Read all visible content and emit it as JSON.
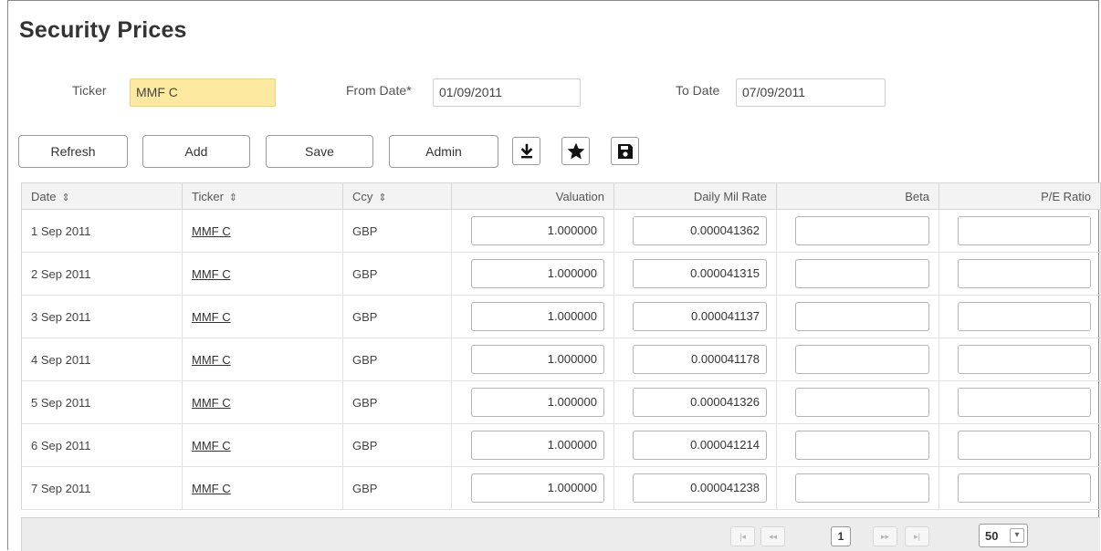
{
  "page": {
    "title": "Security Prices"
  },
  "filters": {
    "ticker_label": "Ticker",
    "ticker_value": "MMF C",
    "from_label": "From Date*",
    "from_value": "01/09/2011",
    "to_label": "To Date",
    "to_value": "07/09/2011"
  },
  "toolbar": {
    "refresh": "Refresh",
    "add": "Add",
    "save": "Save",
    "admin": "Admin",
    "icons": [
      "download-icon",
      "star-icon",
      "floppy-disk-icon"
    ]
  },
  "table": {
    "sort_glyph": "⇕",
    "columns": [
      "Date",
      "Ticker",
      "Ccy",
      "Valuation",
      "Daily Mil Rate",
      "Beta",
      "P/E Ratio"
    ],
    "rows": [
      {
        "date": "1 Sep 2011",
        "ticker": "MMF C",
        "ccy": "GBP",
        "valuation": "1.000000",
        "rate": "0.000041362",
        "beta": "",
        "pe": ""
      },
      {
        "date": "2 Sep 2011",
        "ticker": "MMF C",
        "ccy": "GBP",
        "valuation": "1.000000",
        "rate": "0.000041315",
        "beta": "",
        "pe": ""
      },
      {
        "date": "3 Sep 2011",
        "ticker": "MMF C",
        "ccy": "GBP",
        "valuation": "1.000000",
        "rate": "0.000041137",
        "beta": "",
        "pe": ""
      },
      {
        "date": "4 Sep 2011",
        "ticker": "MMF C",
        "ccy": "GBP",
        "valuation": "1.000000",
        "rate": "0.000041178",
        "beta": "",
        "pe": ""
      },
      {
        "date": "5 Sep 2011",
        "ticker": "MMF C",
        "ccy": "GBP",
        "valuation": "1.000000",
        "rate": "0.000041326",
        "beta": "",
        "pe": ""
      },
      {
        "date": "6 Sep 2011",
        "ticker": "MMF C",
        "ccy": "GBP",
        "valuation": "1.000000",
        "rate": "0.000041214",
        "beta": "",
        "pe": ""
      },
      {
        "date": "7 Sep 2011",
        "ticker": "MMF C",
        "ccy": "GBP",
        "valuation": "1.000000",
        "rate": "0.000041238",
        "beta": "",
        "pe": ""
      }
    ]
  },
  "pager": {
    "first": "|◂",
    "prev": "◂◂",
    "current": "1",
    "next": "▸▸",
    "last": "▸|",
    "page_size": "50"
  }
}
